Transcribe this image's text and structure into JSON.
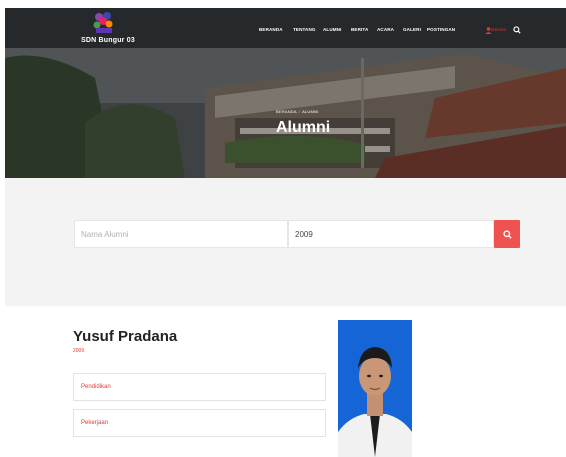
{
  "header": {
    "brand": "SDN Bungur 03",
    "nav": [
      {
        "label": "BERANDA"
      },
      {
        "label": "TENTANG"
      },
      {
        "label": "ALUMNI"
      },
      {
        "label": "BERITA"
      },
      {
        "label": "ACARA"
      },
      {
        "label": "GALERI"
      },
      {
        "label": "POSTINGAN"
      }
    ],
    "login_label": "Gencio",
    "icons": [
      "logo-icon",
      "user-icon",
      "search-icon"
    ]
  },
  "hero": {
    "breadcrumb": [
      "BERANDA",
      "ALUMNI"
    ],
    "title": "Alumni"
  },
  "search": {
    "name_placeholder": "Nama Alumni",
    "year_value": "2009",
    "button_color": "#ef5350"
  },
  "alumnus": {
    "name": "Yusuf Pradana",
    "year": "2009",
    "education_label": "Pendidikan",
    "job_label": "Pekerjaan"
  },
  "colors": {
    "accent": "#e53935",
    "header_bg": "#26292c",
    "photo_bg": "#1565d6"
  }
}
